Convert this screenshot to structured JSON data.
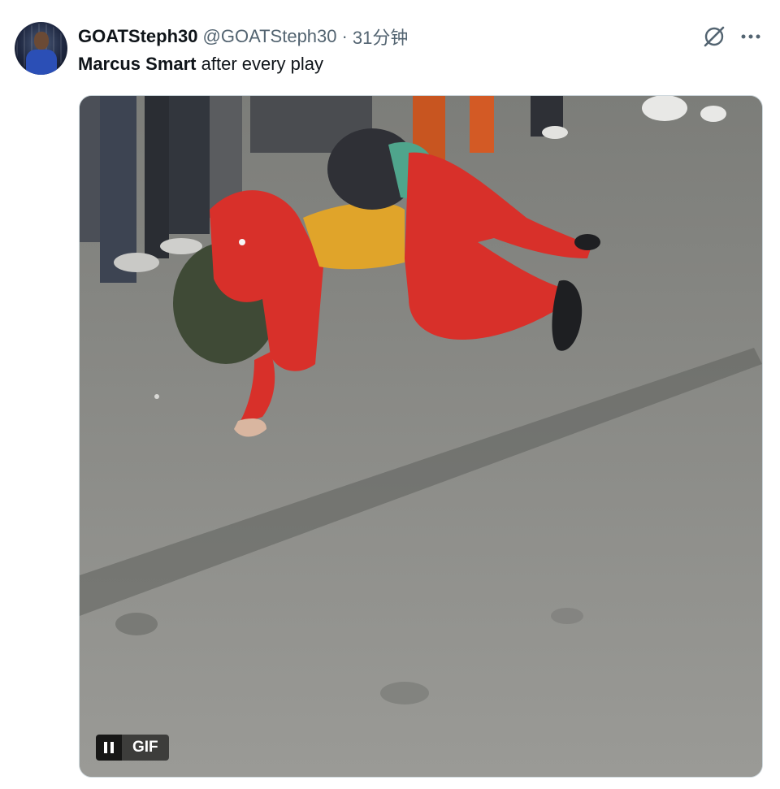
{
  "tweet": {
    "author": {
      "display_name": "GOATSteph30",
      "handle": "@GOATSteph30",
      "avatar_icon": "avatar-image"
    },
    "separator": "·",
    "time": "31分钟",
    "text_bold": "Marcus Smart",
    "text_rest": " after every play",
    "media": {
      "type": "gif",
      "badge": "GIF",
      "pause_icon": "pause-icon",
      "is_playing": true
    },
    "actions": {
      "grok_icon": "grok-icon",
      "more_icon": "more-icon"
    }
  },
  "colors": {
    "text_primary": "#0f1419",
    "text_secondary": "#536471",
    "border": "#cfd9de"
  }
}
